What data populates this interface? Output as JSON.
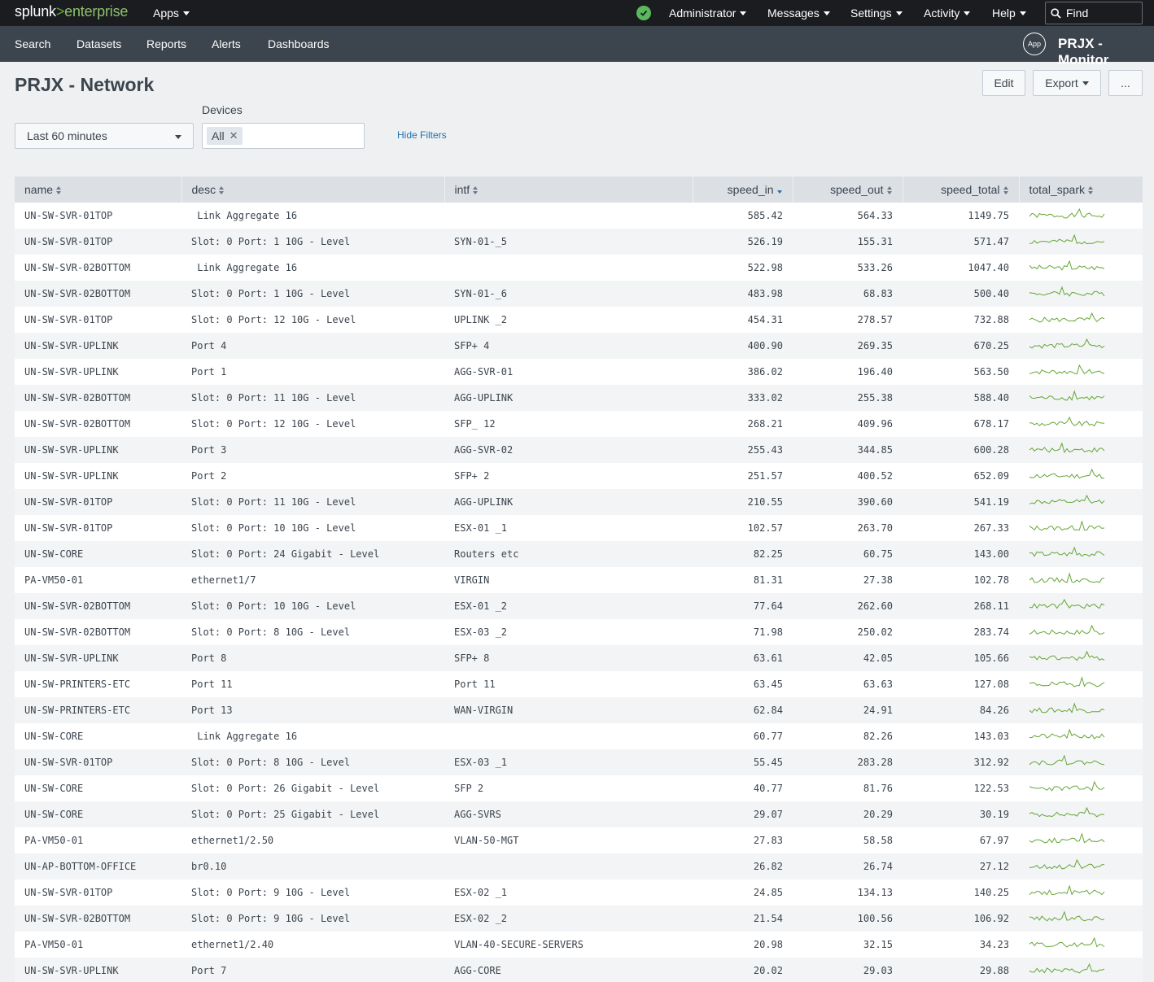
{
  "topbar": {
    "logo_a": "splunk",
    "logo_b": ">",
    "logo_c": "enterprise",
    "apps": "Apps",
    "user": "Administrator",
    "messages": "Messages",
    "settings": "Settings",
    "activity": "Activity",
    "help": "Help",
    "find_placeholder": "Find"
  },
  "appbar": {
    "nav": [
      "Search",
      "Datasets",
      "Reports",
      "Alerts",
      "Dashboards"
    ],
    "app_badge": "App",
    "app_name": "PRJX - Monitor"
  },
  "page": {
    "title": "PRJX - Network",
    "edit": "Edit",
    "export": "Export",
    "more": "..."
  },
  "filters": {
    "time_value": "Last 60 minutes",
    "devices_label": "Devices",
    "devices_token": "All",
    "hide_filters": "Hide Filters"
  },
  "colors": {
    "spark": "#65a637",
    "sort_active": "#1e73b0",
    "status_ok": "#5cb85c"
  },
  "table": {
    "columns": [
      "name",
      "desc",
      "intf",
      "speed_in",
      "speed_out",
      "speed_total",
      "total_spark"
    ],
    "sorted_column": "speed_in",
    "sort_direction": "descending",
    "rows": [
      [
        "UN-SW-SVR-01TOP",
        " Link Aggregate 16",
        "",
        "585.42",
        "564.33",
        "1149.75"
      ],
      [
        "UN-SW-SVR-01TOP",
        "Slot: 0 Port: 1 10G - Level",
        "SYN-01-_5",
        "526.19",
        "155.31",
        "571.47"
      ],
      [
        "UN-SW-SVR-02BOTTOM",
        " Link Aggregate 16",
        "",
        "522.98",
        "533.26",
        "1047.40"
      ],
      [
        "UN-SW-SVR-02BOTTOM",
        "Slot: 0 Port: 1 10G - Level",
        "SYN-01-_6",
        "483.98",
        "68.83",
        "500.40"
      ],
      [
        "UN-SW-SVR-01TOP",
        "Slot: 0 Port: 12 10G - Level",
        "UPLINK _2",
        "454.31",
        "278.57",
        "732.88"
      ],
      [
        "UN-SW-SVR-UPLINK",
        "Port 4",
        "SFP+ 4",
        "400.90",
        "269.35",
        "670.25"
      ],
      [
        "UN-SW-SVR-UPLINK",
        "Port 1",
        "AGG-SVR-01",
        "386.02",
        "196.40",
        "563.50"
      ],
      [
        "UN-SW-SVR-02BOTTOM",
        "Slot: 0 Port: 11 10G - Level",
        "AGG-UPLINK",
        "333.02",
        "255.38",
        "588.40"
      ],
      [
        "UN-SW-SVR-02BOTTOM",
        "Slot: 0 Port: 12 10G - Level",
        "SFP_ 12",
        "268.21",
        "409.96",
        "678.17"
      ],
      [
        "UN-SW-SVR-UPLINK",
        "Port 3",
        "AGG-SVR-02",
        "255.43",
        "344.85",
        "600.28"
      ],
      [
        "UN-SW-SVR-UPLINK",
        "Port 2",
        "SFP+ 2",
        "251.57",
        "400.52",
        "652.09"
      ],
      [
        "UN-SW-SVR-01TOP",
        "Slot: 0 Port: 11 10G - Level",
        "AGG-UPLINK",
        "210.55",
        "390.60",
        "541.19"
      ],
      [
        "UN-SW-SVR-01TOP",
        "Slot: 0 Port: 10 10G - Level",
        "ESX-01 _1",
        "102.57",
        "263.70",
        "267.33"
      ],
      [
        "UN-SW-CORE",
        "Slot: 0 Port: 24 Gigabit - Level",
        "Routers etc",
        "82.25",
        "60.75",
        "143.00"
      ],
      [
        "PA-VM50-01",
        "ethernet1/7",
        "VIRGIN",
        "81.31",
        "27.38",
        "102.78"
      ],
      [
        "UN-SW-SVR-02BOTTOM",
        "Slot: 0 Port: 10 10G - Level",
        "ESX-01 _2",
        "77.64",
        "262.60",
        "268.11"
      ],
      [
        "UN-SW-SVR-02BOTTOM",
        "Slot: 0 Port: 8 10G - Level",
        "ESX-03 _2",
        "71.98",
        "250.02",
        "283.74"
      ],
      [
        "UN-SW-SVR-UPLINK",
        "Port 8",
        "SFP+ 8",
        "63.61",
        "42.05",
        "105.66"
      ],
      [
        "UN-SW-PRINTERS-ETC",
        "Port 11",
        "Port 11",
        "63.45",
        "63.63",
        "127.08"
      ],
      [
        "UN-SW-PRINTERS-ETC",
        "Port 13",
        "WAN-VIRGIN",
        "62.84",
        "24.91",
        "84.26"
      ],
      [
        "UN-SW-CORE",
        " Link Aggregate 16",
        "",
        "60.77",
        "82.26",
        "143.03"
      ],
      [
        "UN-SW-SVR-01TOP",
        "Slot: 0 Port: 8 10G - Level",
        "ESX-03 _1",
        "55.45",
        "283.28",
        "312.92"
      ],
      [
        "UN-SW-CORE",
        "Slot: 0 Port: 26 Gigabit - Level",
        "SFP 2",
        "40.77",
        "81.76",
        "122.53"
      ],
      [
        "UN-SW-CORE",
        "Slot: 0 Port: 25 Gigabit - Level",
        "AGG-SVRS",
        "29.07",
        "20.29",
        "30.19"
      ],
      [
        "PA-VM50-01",
        "ethernet1/2.50",
        "VLAN-50-MGT",
        "27.83",
        "58.58",
        "67.97"
      ],
      [
        "UN-AP-BOTTOM-OFFICE",
        "br0.10",
        "",
        "26.82",
        "26.74",
        "27.12"
      ],
      [
        "UN-SW-SVR-01TOP",
        "Slot: 0 Port: 9 10G - Level",
        "ESX-02 _1",
        "24.85",
        "134.13",
        "140.25"
      ],
      [
        "UN-SW-SVR-02BOTTOM",
        "Slot: 0 Port: 9 10G - Level",
        "ESX-02 _2",
        "21.54",
        "100.56",
        "106.92"
      ],
      [
        "PA-VM50-01",
        "ethernet1/2.40",
        "VLAN-40-SECURE-SERVERS",
        "20.98",
        "32.15",
        "34.23"
      ],
      [
        "UN-SW-SVR-UPLINK",
        "Port 7",
        "AGG-CORE",
        "20.02",
        "29.03",
        "29.88"
      ]
    ]
  }
}
